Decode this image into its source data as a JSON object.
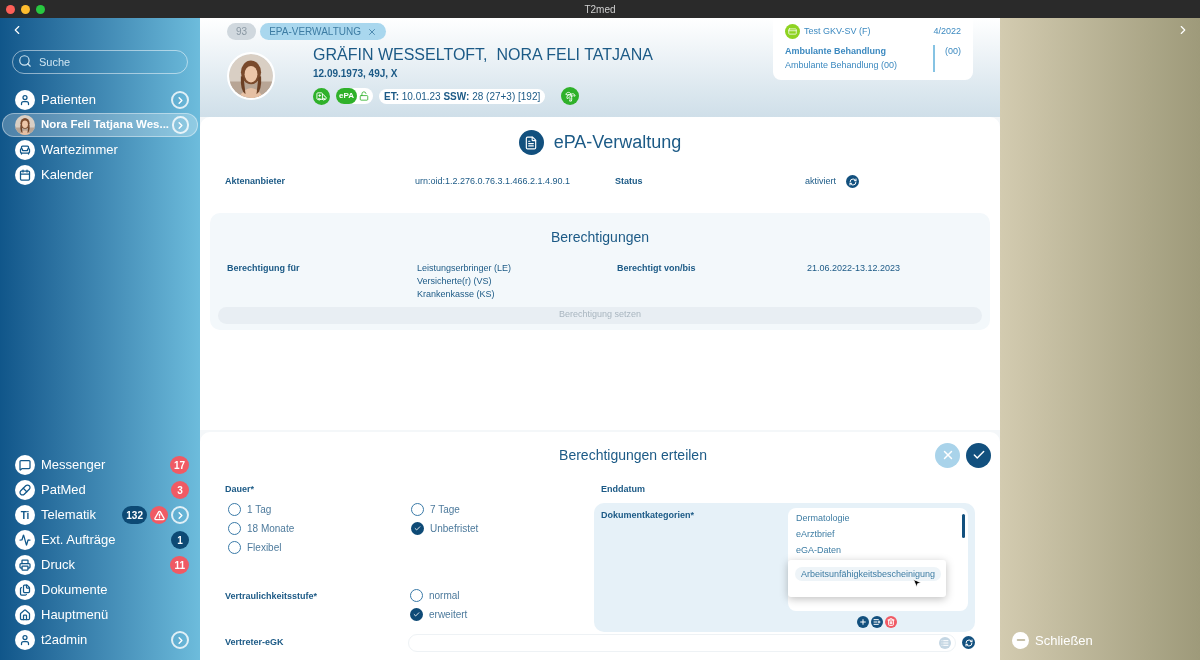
{
  "window": {
    "title": "T2med"
  },
  "sidebar": {
    "search": {
      "placeholder": "Suche"
    },
    "top_items": [
      {
        "kind": "nav",
        "label": "Patienten",
        "selected": false,
        "chevron": true,
        "alert": false
      },
      {
        "kind": "patient",
        "label": "Nora Feli Tatjana Wes...",
        "selected": true,
        "chevron": true,
        "alert": false
      },
      {
        "kind": "nav",
        "label": "Wartezimmer",
        "selected": false,
        "chevron": false,
        "alert": false
      },
      {
        "kind": "nav",
        "label": "Kalender",
        "selected": false,
        "chevron": false,
        "alert": false
      }
    ],
    "bottom_items": [
      {
        "kind": "nav",
        "label": "Messenger",
        "selected": false,
        "chevron": false,
        "alert": false,
        "badges": [
          {
            "text": "17",
            "color": "#f05a64"
          }
        ]
      },
      {
        "kind": "nav",
        "label": "PatMed",
        "selected": false,
        "chevron": false,
        "alert": false,
        "badges": [
          {
            "text": "3",
            "color": "#f05a64"
          }
        ]
      },
      {
        "kind": "text-icon",
        "icon_text": "Ti",
        "label": "Telematik",
        "selected": false,
        "chevron": true,
        "alert": true,
        "badges": [
          {
            "text": "132",
            "color": "#0d4a75"
          }
        ]
      },
      {
        "kind": "nav",
        "label": "Ext. Aufträge",
        "selected": false,
        "chevron": false,
        "alert": false,
        "badges": [
          {
            "text": "1",
            "color": "#0d4a75"
          }
        ]
      },
      {
        "kind": "nav",
        "label": "Druck",
        "selected": false,
        "chevron": false,
        "alert": false,
        "badges": [
          {
            "text": "11",
            "color": "#f05a64"
          }
        ]
      },
      {
        "kind": "nav",
        "label": "Dokumente",
        "selected": false,
        "chevron": false,
        "alert": false
      },
      {
        "kind": "nav",
        "label": "Hauptmenü",
        "selected": false,
        "chevron": false,
        "alert": false
      },
      {
        "kind": "nav",
        "label": "t2admin",
        "selected": false,
        "chevron": true,
        "alert": false
      }
    ]
  },
  "header": {
    "tabs": [
      {
        "label": "93",
        "selected": false,
        "closable": false
      },
      {
        "label": "EPA-VERWALTUNG",
        "selected": true,
        "closable": true
      }
    ],
    "patient": {
      "name": "GRÄFIN WESSELTOFT,  NORA FELI TATJANA",
      "details": "12.09.1973, 49J, X",
      "epa_label": "ePA",
      "pregnancy": "**ET:** 10.01.23 **SSW:** 28 (27+3) [192]"
    },
    "insurance": {
      "name": "Test GKV-SV (F)",
      "quarter": "4/2022",
      "treatment": "Ambulante Behandlung",
      "treatment_detail": "Ambulante Behandlung (00)",
      "code": "(00)"
    }
  },
  "epa": {
    "title": "ePA-Verwaltung",
    "fields": [
      {
        "label": "Aktenanbieter",
        "value": "urn:oid:1.2.276.0.76.3.1.466.2.1.4.90.1"
      },
      {
        "label": "Status",
        "value": "aktiviert"
      }
    ],
    "permissions": {
      "title": "Berechtigungen",
      "for_label": "Berechtigung für",
      "for_values": [
        "Leistungserbringer (LE)",
        "Versicherte(r) (VS)",
        "Krankenkasse (KS)"
      ],
      "period_label": "Berechtigt von/bis",
      "period_value": "21.06.2022-13.12.2023",
      "button": {
        "label": "Berechtigung setzen",
        "disabled": true
      }
    }
  },
  "grant": {
    "title": "Berechtigungen erteilen",
    "duration": {
      "label": "Dauer*",
      "options": [
        {
          "label": "1 Tag",
          "selected": false
        },
        {
          "label": "7 Tage",
          "selected": false
        },
        {
          "label": "18 Monate",
          "selected": false
        },
        {
          "label": "Unbefristet",
          "selected": true
        },
        {
          "label": "Flexibel",
          "selected": false
        }
      ]
    },
    "end_date": {
      "label": "Enddatum"
    },
    "categories": {
      "label": "Dokumentkategorien*",
      "items": [
        "Dermatologie",
        "eArztbrief",
        "eGA-Daten"
      ],
      "popup": {
        "item": "Arbeitsunfähigkeitsbescheinigung"
      }
    },
    "confidentiality": {
      "label": "Vertraulichkeitsstufe*",
      "options": [
        {
          "label": "normal",
          "selected": false
        },
        {
          "label": "erweitert",
          "selected": true
        }
      ]
    },
    "representative": {
      "label": "Vertreter-eGK"
    }
  },
  "right_panel": {
    "close": "Schließen"
  }
}
